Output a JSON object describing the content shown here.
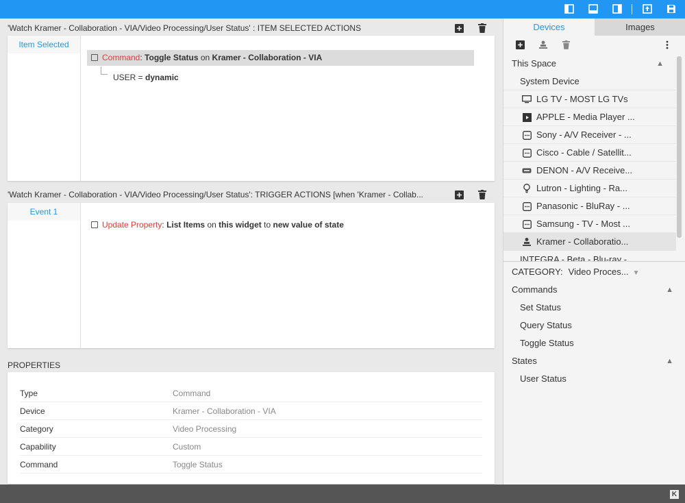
{
  "topbar": {
    "icons": [
      "panel-left-icon",
      "panel-bottom-icon",
      "panel-right-icon",
      "upload-icon",
      "save-icon"
    ]
  },
  "selected_actions": {
    "title": "'Watch Kramer - Collaboration - VIA/Video Processing/User Status' : ITEM SELECTED ACTIONS",
    "tab_label": "Item Selected",
    "command_prefix": "Command",
    "command_colon": ":",
    "command_name": "Toggle Status",
    "command_on": "on",
    "command_device": "Kramer - Collaboration - VIA",
    "param_key": "USER =",
    "param_value": "dynamic"
  },
  "trigger_actions": {
    "title": "'Watch Kramer - Collaboration - VIA/Video Processing/User Status': TRIGGER ACTIONS [when 'Kramer - Collab...",
    "tab_label": "Event 1",
    "update_prefix": "Update Property",
    "update_colon": ":",
    "update_prop": "List Items",
    "update_on": "on",
    "update_target": "this widget",
    "update_to": "to",
    "update_value": "new value of state"
  },
  "properties": {
    "title": "PROPERTIES",
    "rows": [
      {
        "key": "Type",
        "value": "Command"
      },
      {
        "key": "Device",
        "value": "Kramer - Collaboration - VIA"
      },
      {
        "key": "Category",
        "value": "Video Processing"
      },
      {
        "key": "Capability",
        "value": "Custom"
      },
      {
        "key": "Command",
        "value": "Toggle Status"
      }
    ]
  },
  "sidebar": {
    "tabs": [
      {
        "label": "Devices",
        "active": true
      },
      {
        "label": "Images",
        "active": false
      }
    ],
    "group_header": "This Space",
    "system_device": "System Device",
    "devices": [
      {
        "label": "LG TV - MOST LG TVs",
        "icon": "tv-icon"
      },
      {
        "label": "APPLE - Media Player ...",
        "icon": "film-icon"
      },
      {
        "label": "Sony - A/V Receiver - ...",
        "icon": "receiver-icon"
      },
      {
        "label": "Cisco - Cable / Satellit...",
        "icon": "receiver-icon"
      },
      {
        "label": "DENON - A/V Receive...",
        "icon": "rack-icon"
      },
      {
        "label": "Lutron - Lighting - Ra...",
        "icon": "bulb-icon"
      },
      {
        "label": "Panasonic - BluRay - ...",
        "icon": "receiver-icon"
      },
      {
        "label": "Samsung - TV - Most ...",
        "icon": "receiver-icon"
      },
      {
        "label": "Kramer - Collaboratio...",
        "icon": "presenter-icon",
        "selected": true
      },
      {
        "label": "INTEGRA - Beta - Blu-ray - ...",
        "icon": ""
      }
    ],
    "category_label": "CATEGORY:",
    "category_value": "Video Proces...",
    "commands_header": "Commands",
    "commands": [
      "Set Status",
      "Query Status",
      "Toggle Status"
    ],
    "states_header": "States",
    "states": [
      "User Status"
    ]
  },
  "colors": {
    "accent": "#2196f3",
    "red": "#e53935"
  }
}
